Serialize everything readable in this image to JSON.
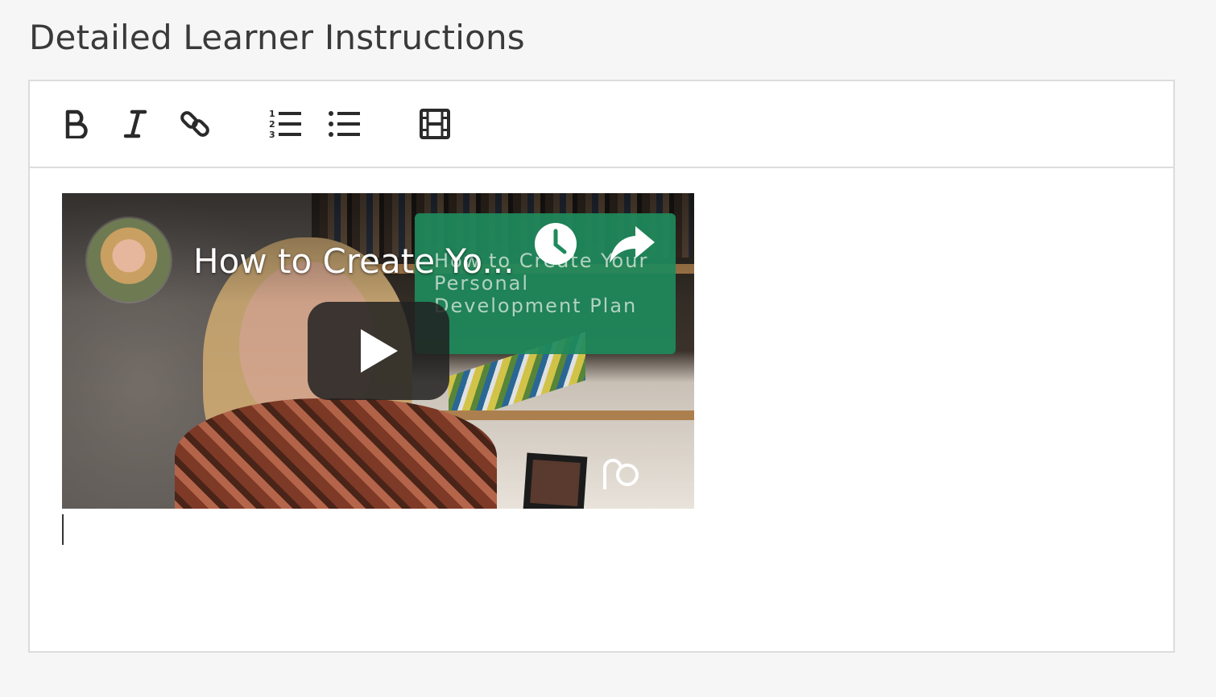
{
  "section": {
    "title": "Detailed Learner Instructions"
  },
  "toolbar": {
    "buttons": [
      {
        "name": "bold-button",
        "icon": "bold-icon",
        "tooltip": ""
      },
      {
        "name": "italic-button",
        "icon": "italic-icon"
      },
      {
        "name": "link-button",
        "icon": "link-icon"
      },
      {
        "name": "ordered-list-button",
        "icon": "ordered-list-icon"
      },
      {
        "name": "unordered-list-button",
        "icon": "unordered-list-icon"
      },
      {
        "name": "video-button",
        "icon": "film-icon"
      }
    ]
  },
  "video": {
    "title": "How to Create Yo...",
    "card_text": "How to Create Your Personal Development Plan",
    "icons": [
      "avatar",
      "clock-icon",
      "share-icon",
      "play-icon",
      "watermark-logo"
    ],
    "card_color": "#1f8a5c"
  },
  "colors": {
    "border": "#dcdcdc",
    "background": "#f6f6f6",
    "title": "#3a3a3a"
  }
}
